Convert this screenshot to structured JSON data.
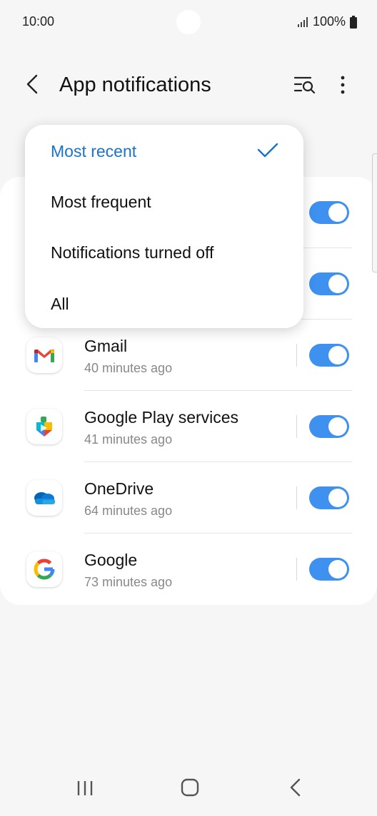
{
  "status": {
    "time": "10:00",
    "battery": "100%"
  },
  "appbar": {
    "title": "App notifications"
  },
  "menu": {
    "items": [
      {
        "label": "Most recent",
        "selected": true
      },
      {
        "label": "Most frequent",
        "selected": false
      },
      {
        "label": "Notifications turned off",
        "selected": false
      },
      {
        "label": "All",
        "selected": false
      }
    ]
  },
  "apps": [
    {
      "name": "Gmail",
      "time": "40 minutes ago",
      "enabled": true,
      "icon": "gmail-icon"
    },
    {
      "name": "Google Play services",
      "time": "41 minutes ago",
      "enabled": true,
      "icon": "google-play-services-icon"
    },
    {
      "name": "OneDrive",
      "time": "64 minutes ago",
      "enabled": true,
      "icon": "onedrive-icon"
    },
    {
      "name": "Google",
      "time": "73 minutes ago",
      "enabled": true,
      "icon": "google-icon"
    }
  ],
  "colors": {
    "accent": "#3e91ef",
    "selected_text": "#1a73c9"
  }
}
